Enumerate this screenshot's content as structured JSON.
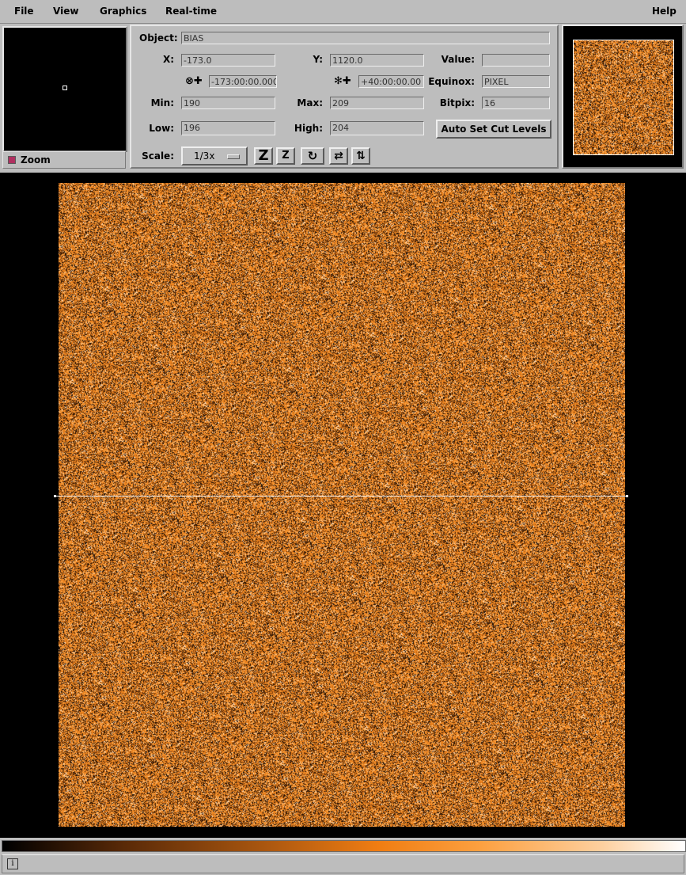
{
  "menubar": {
    "file": "File",
    "view": "View",
    "graphics": "Graphics",
    "realtime": "Real-time",
    "help": "Help"
  },
  "panner": {
    "zoom_label": "Zoom"
  },
  "info": {
    "object_label": "Object:",
    "object_value": "BIAS",
    "x_label": "X:",
    "x_value": "-173.0",
    "y_label": "Y:",
    "y_value": "1120.0",
    "value_label": "Value:",
    "value_value": "",
    "ra_value": "-173:00:00.000",
    "dec_value": "+40:00:00.00",
    "equinox_label": "Equinox:",
    "equinox_value": "PIXEL",
    "min_label": "Min:",
    "min_value": "190",
    "max_label": "Max:",
    "max_value": "209",
    "bitpix_label": "Bitpix:",
    "bitpix_value": "16",
    "low_label": "Low:",
    "low_value": "196",
    "high_label": "High:",
    "high_value": "204",
    "auto_cut_label": "Auto Set Cut Levels",
    "scale_label": "Scale:",
    "scale_value": "1/3x"
  },
  "colors": {
    "image_orange": "#f08a1e",
    "background": "#bdbdbd"
  }
}
